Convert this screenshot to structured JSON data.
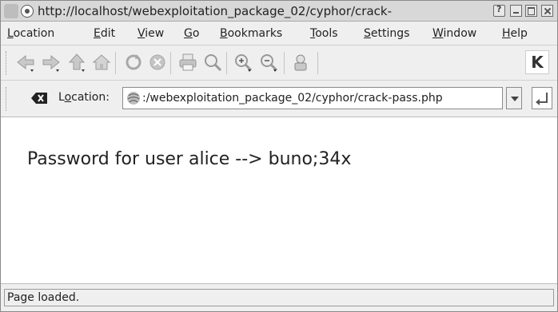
{
  "window": {
    "title": "http://localhost/webexploitation_package_02/cyphor/crack-"
  },
  "menubar": {
    "items": [
      {
        "accel": "L",
        "rest": "ocation"
      },
      {
        "accel": "E",
        "rest": "dit"
      },
      {
        "accel": "V",
        "rest": "iew"
      },
      {
        "accel": "G",
        "rest": "o"
      },
      {
        "accel": "B",
        "rest": "ookmarks"
      },
      {
        "accel": "T",
        "rest": "ools"
      },
      {
        "accel": "S",
        "rest": "ettings"
      },
      {
        "accel": "W",
        "rest": "indow"
      },
      {
        "accel": "H",
        "rest": "elp"
      }
    ]
  },
  "toolbar": {
    "buttons": [
      "back-icon",
      "forward-icon",
      "up-icon",
      "home-icon",
      "reload-icon",
      "stop-icon",
      "print-icon",
      "find-icon",
      "zoom-in-icon",
      "zoom-out-icon",
      "security-icon"
    ],
    "logo_text": "K"
  },
  "locationbar": {
    "label_prefix": "L",
    "label_accel": "o",
    "label_rest": "cation:",
    "url": ":/webexploitation_package_02/cyphor/crack-pass.php"
  },
  "content": {
    "message": "Password for user alice --> buno;34x"
  },
  "statusbar": {
    "text": "Page loaded."
  },
  "colors": {
    "chrome": "#efefef",
    "titlebar": "#d8d8d8",
    "content_bg": "#ffffff",
    "text": "#222222"
  }
}
